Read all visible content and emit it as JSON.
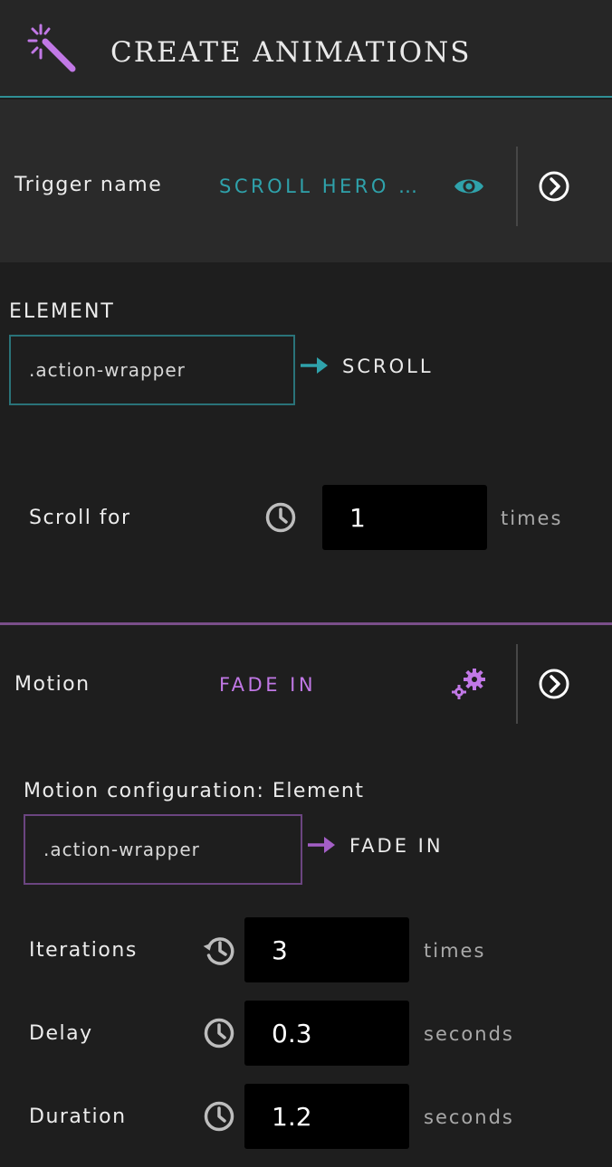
{
  "header": {
    "title": "CREATE ANIMATIONS",
    "icon": "magic-wand-icon",
    "icon_color": "#c178e6"
  },
  "trigger": {
    "label": "Trigger name",
    "value": "SCROLL HERO …",
    "accent": "#2fa2ab"
  },
  "element": {
    "heading": "ELEMENT",
    "selector": ".action-wrapper",
    "event": "SCROLL",
    "scroll_label": "Scroll for",
    "scroll_value": "1",
    "scroll_unit": "times"
  },
  "motion": {
    "label": "Motion",
    "value": "FADE IN",
    "accent": "#c178e6",
    "config_heading": "Motion configuration: Element",
    "selector": ".action-wrapper",
    "effect": "FADE IN",
    "params": {
      "iterations": {
        "label": "Iterations",
        "value": "3",
        "unit": "times"
      },
      "delay": {
        "label": "Delay",
        "value": "0.3",
        "unit": "seconds"
      },
      "duration": {
        "label": "Duration",
        "value": "1.2",
        "unit": "seconds"
      }
    }
  }
}
